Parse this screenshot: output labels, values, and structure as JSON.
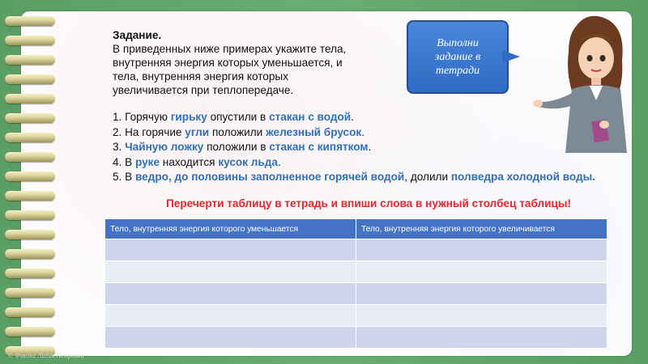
{
  "task": {
    "heading": "Задание.",
    "lines": [
      "В приведенных ниже примерах укажите тела,",
      "внутренняя энергия которых уменьшается, и",
      "тела, внутренняя энергия которых",
      "увеличивается при теплопередаче."
    ]
  },
  "examples": [
    {
      "parts": [
        {
          "t": "1. Горячую "
        },
        {
          "t": "гирьку",
          "hl": true
        },
        {
          "t": " опустили в "
        },
        {
          "t": "стакан с водой",
          "hl": true
        },
        {
          "t": "."
        }
      ]
    },
    {
      "parts": [
        {
          "t": "2. На горячие  "
        },
        {
          "t": "угли",
          "hl": true
        },
        {
          "t": " положили "
        },
        {
          "t": "железный брусок",
          "hl": true
        },
        {
          "t": "."
        }
      ]
    },
    {
      "parts": [
        {
          "t": "3. "
        },
        {
          "t": "Чайную ложку",
          "hl": true
        },
        {
          "t": " положили в "
        },
        {
          "t": "стакан с кипятком",
          "hl": true
        },
        {
          "t": "."
        }
      ]
    },
    {
      "parts": [
        {
          "t": "4. В "
        },
        {
          "t": "руке",
          "hl": true
        },
        {
          "t": " находится "
        },
        {
          "t": "кусок льда",
          "hl": true
        },
        {
          "t": "."
        }
      ]
    },
    {
      "parts": [
        {
          "t": "5. В "
        },
        {
          "t": "ведро, до половины заполненное горячей водой",
          "hl": true
        },
        {
          "t": ", долили "
        },
        {
          "t": "полведра",
          "hl": true
        },
        {
          "t": " "
        },
        {
          "t": "холодной воды.",
          "hl": true
        }
      ]
    }
  ],
  "bubble": {
    "line1": "Выполни",
    "line2": "задание в",
    "line3": "тетради"
  },
  "instruction": "Перечерти таблицу в тетрадь и впиши слова в нужный столбец таблицы!",
  "table": {
    "headers": [
      "Тело, внутренняя энергия которого уменьшается",
      "Тело, внутренняя энергия которого увеличивается"
    ],
    "empty_rows": 5
  },
  "footer": "© Фокина Лидия Петровна",
  "colors": {
    "accent_blue": "#2e70c0",
    "instruction_red": "#e8262b",
    "table_header": "#4472c4"
  }
}
